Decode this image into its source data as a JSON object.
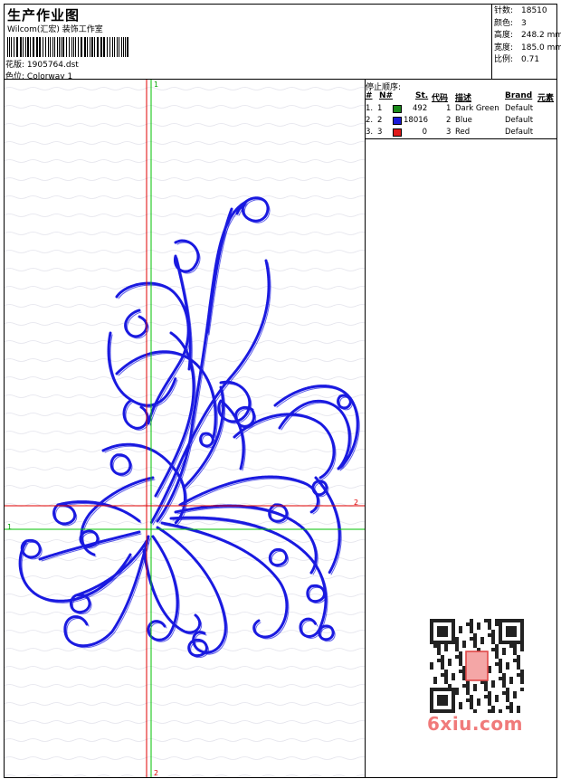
{
  "header": {
    "title": "生产作业图",
    "company": "Wilcom(汇宏) 装饰工作室",
    "pattern_label": "花版:",
    "pattern_value": "1905764.dst",
    "colorway_label": "色位:",
    "colorway_value": "Colorway 1"
  },
  "stats": [
    {
      "label": "针数:",
      "value": "18510"
    },
    {
      "label": "颜色:",
      "value": "3"
    },
    {
      "label": "高度:",
      "value": "248.2 mm"
    },
    {
      "label": "宽度:",
      "value": "185.0 mm"
    },
    {
      "label": "比例:",
      "value": "0.71"
    }
  ],
  "stop_sequence": {
    "title": "停止顺序:",
    "columns": {
      "hash": "#",
      "no": "N#",
      "st": "St.",
      "code": "代码",
      "desc": "描述",
      "brand": "Brand",
      "element": "元素"
    },
    "rows": [
      {
        "idx": "1.",
        "no": "1",
        "color": "#1a8a1a",
        "st": "492",
        "code": "1",
        "desc": "Dark Green",
        "brand": "Default"
      },
      {
        "idx": "2.",
        "no": "2",
        "color": "#1a1ad8",
        "st": "18016",
        "code": "2",
        "desc": "Blue",
        "brand": "Default"
      },
      {
        "idx": "3.",
        "no": "3",
        "color": "#e01818",
        "st": "0",
        "code": "3",
        "desc": "Red",
        "brand": "Default"
      }
    ]
  },
  "canvas": {
    "axis_label_top": "1",
    "axis_label_bottom": "2",
    "axis_label_left": "1",
    "axis_label_right": "2",
    "stitch_color": "#1a1ae0",
    "axis_green": "#00c000",
    "axis_red": "#e00000"
  },
  "watermark": "6xiu.com"
}
